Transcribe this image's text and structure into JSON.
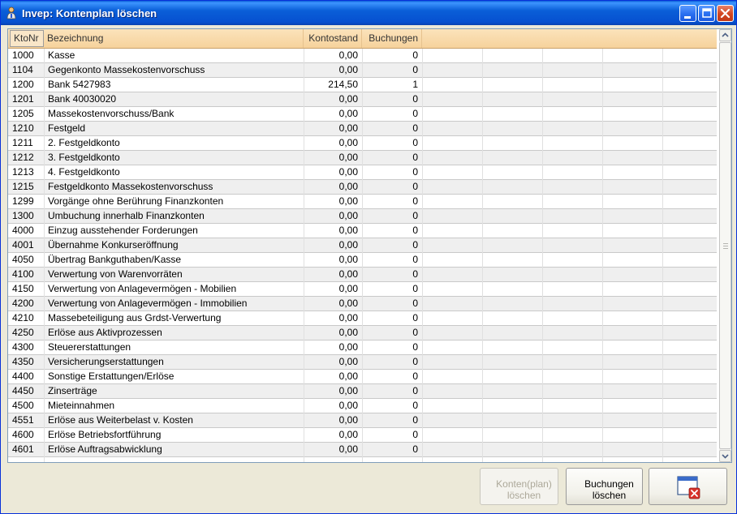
{
  "window": {
    "title": "Invep: Kontenplan löschen"
  },
  "table": {
    "columns": [
      "KtoNr",
      "Bezeichnung",
      "Kontostand",
      "Buchungen"
    ],
    "rows": [
      [
        "1000",
        "Kasse",
        "0,00",
        "0"
      ],
      [
        "1104",
        "Gegenkonto Massekostenvorschuss",
        "0,00",
        "0"
      ],
      [
        "1200",
        "Bank 5427983",
        "214,50",
        "1"
      ],
      [
        "1201",
        "Bank 40030020",
        "0,00",
        "0"
      ],
      [
        "1205",
        "Massekostenvorschuss/Bank",
        "0,00",
        "0"
      ],
      [
        "1210",
        "Festgeld",
        "0,00",
        "0"
      ],
      [
        "1211",
        "2. Festgeldkonto",
        "0,00",
        "0"
      ],
      [
        "1212",
        "3. Festgeldkonto",
        "0,00",
        "0"
      ],
      [
        "1213",
        "4. Festgeldkonto",
        "0,00",
        "0"
      ],
      [
        "1215",
        "Festgeldkonto Massekostenvorschuss",
        "0,00",
        "0"
      ],
      [
        "1299",
        "Vorgänge ohne Berührung Finanzkonten",
        "0,00",
        "0"
      ],
      [
        "1300",
        "Umbuchung innerhalb Finanzkonten",
        "0,00",
        "0"
      ],
      [
        "4000",
        "Einzug ausstehender Forderungen",
        "0,00",
        "0"
      ],
      [
        "4001",
        "Übernahme Konkurseröffnung",
        "0,00",
        "0"
      ],
      [
        "4050",
        "Übertrag Bankguthaben/Kasse",
        "0,00",
        "0"
      ],
      [
        "4100",
        "Verwertung von Warenvorräten",
        "0,00",
        "0"
      ],
      [
        "4150",
        "Verwertung von Anlagevermögen - Mobilien",
        "0,00",
        "0"
      ],
      [
        "4200",
        "Verwertung von Anlagevermögen - Immobilien",
        "0,00",
        "0"
      ],
      [
        "4210",
        "Massebeteiligung aus Grdst-Verwertung",
        "0,00",
        "0"
      ],
      [
        "4250",
        "Erlöse aus Aktivprozessen",
        "0,00",
        "0"
      ],
      [
        "4300",
        "Steuererstattungen",
        "0,00",
        "0"
      ],
      [
        "4350",
        "Versicherungserstattungen",
        "0,00",
        "0"
      ],
      [
        "4400",
        "Sonstige Erstattungen/Erlöse",
        "0,00",
        "0"
      ],
      [
        "4450",
        "Zinserträge",
        "0,00",
        "0"
      ],
      [
        "4500",
        "Mieteinnahmen",
        "0,00",
        "0"
      ],
      [
        "4551",
        "Erlöse aus Weiterbelast v. Kosten",
        "0,00",
        "0"
      ],
      [
        "4600",
        "Erlöse Betriebsfortführung",
        "0,00",
        "0"
      ],
      [
        "4601",
        "Erlöse Auftragsabwicklung",
        "0,00",
        "0"
      ]
    ]
  },
  "buttons": {
    "delete_accounts": {
      "line1": "Konten(plan)",
      "line2": "löschen",
      "enabled": false
    },
    "delete_bookings": {
      "line1": "Buchungen",
      "line2": "löschen",
      "enabled": true
    }
  },
  "icons": {
    "app": "app-icon",
    "minimize": "minimize-icon",
    "maximize": "maximize-icon",
    "close": "close-icon",
    "close_window": "window-close-icon"
  },
  "colors": {
    "title_bar": "#0a5fd8",
    "header_bg": "#f6d29c",
    "alt_row": "#efefef",
    "close_red": "#d2451f"
  }
}
